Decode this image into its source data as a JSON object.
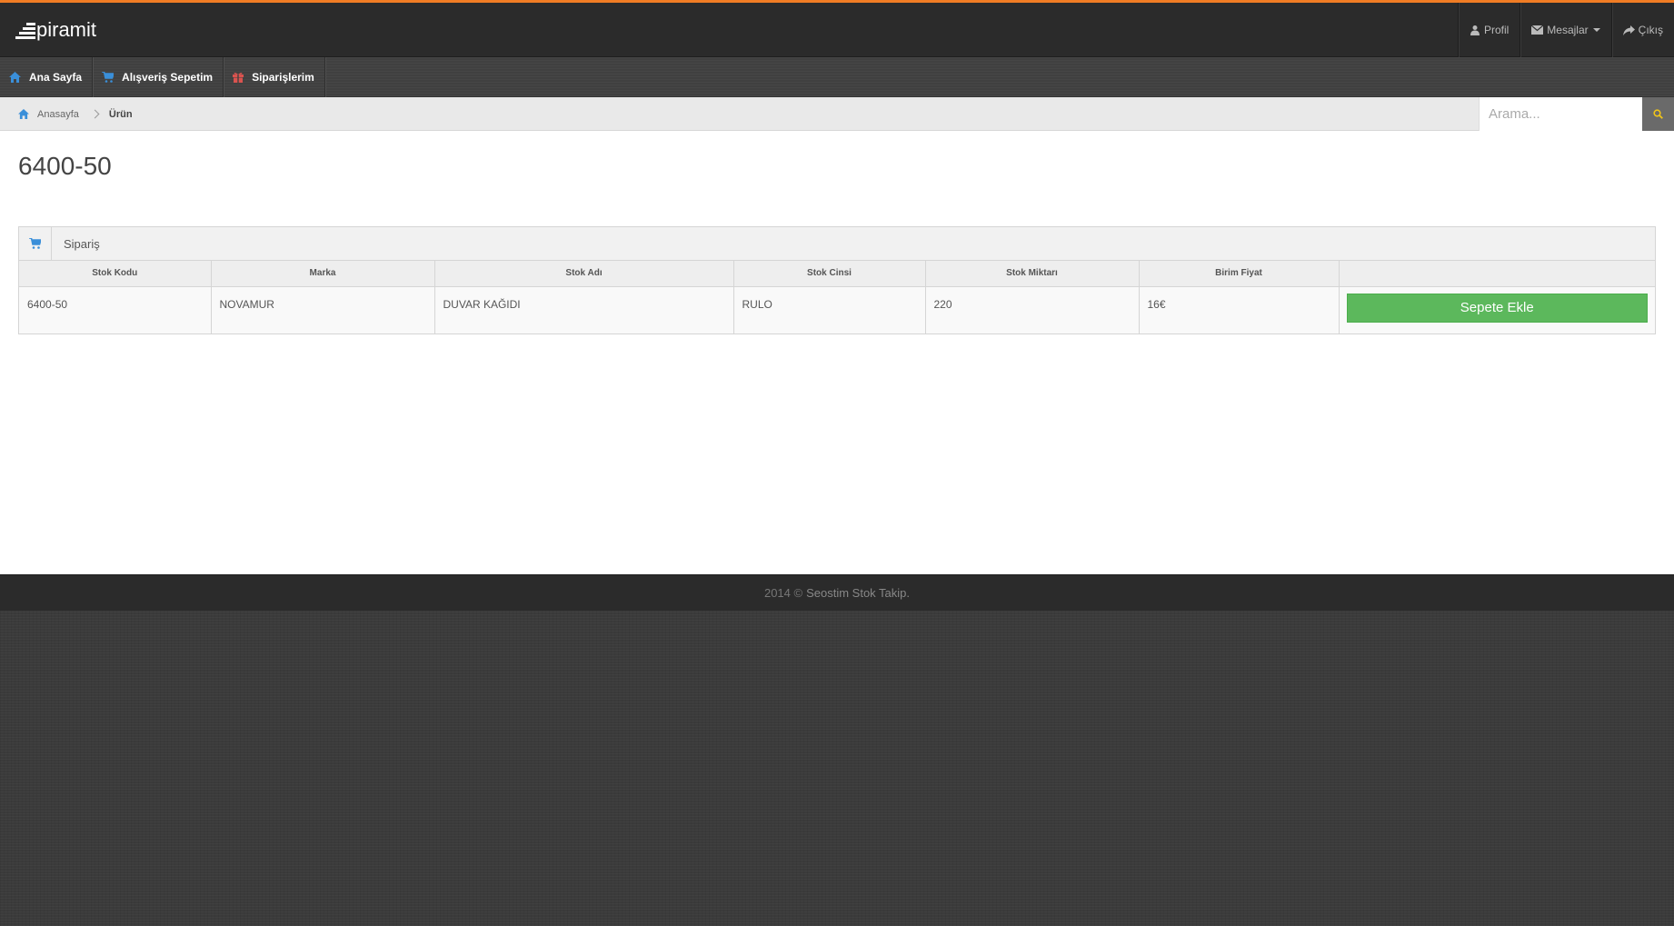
{
  "brand": {
    "name": "piramit",
    "accent": "#f07c24"
  },
  "topnav": {
    "profile": {
      "label": "Profil",
      "icon": "user-icon"
    },
    "messages": {
      "label": "Mesajlar",
      "icon": "envelope-icon"
    },
    "logout": {
      "label": "Çıkış",
      "icon": "share-icon"
    }
  },
  "mainnav": {
    "items": [
      {
        "label": "Ana Sayfa",
        "icon": "home-icon",
        "color": "#3a8fd9"
      },
      {
        "label": "Alışveriş Sepetim",
        "icon": "cart-icon",
        "color": "#3a8fd9"
      },
      {
        "label": "Siparişlerim",
        "icon": "gift-icon",
        "color": "#d9534f"
      }
    ]
  },
  "breadcrumb": {
    "home": "Anasayfa",
    "current": "Ürün"
  },
  "search": {
    "placeholder": "Arama..."
  },
  "page": {
    "title": "6400-50"
  },
  "widget": {
    "title": "Sipariş",
    "columns": [
      "Stok Kodu",
      "Marka",
      "Stok Adı",
      "Stok Cinsi",
      "Stok Miktarı",
      "Birim Fiyat",
      ""
    ],
    "rows": [
      {
        "stok_kodu": "6400-50",
        "marka": "NOVAMUR",
        "stok_adi": "DUVAR KAĞIDI",
        "stok_cinsi": "RULO",
        "stok_miktari": "220",
        "birim_fiyat": "16€"
      }
    ],
    "action_label": "Sepete Ekle",
    "action_color": "#5cb85c"
  },
  "footer": {
    "prefix": "2014 ©",
    "link": "Seostim Stok Takip."
  }
}
